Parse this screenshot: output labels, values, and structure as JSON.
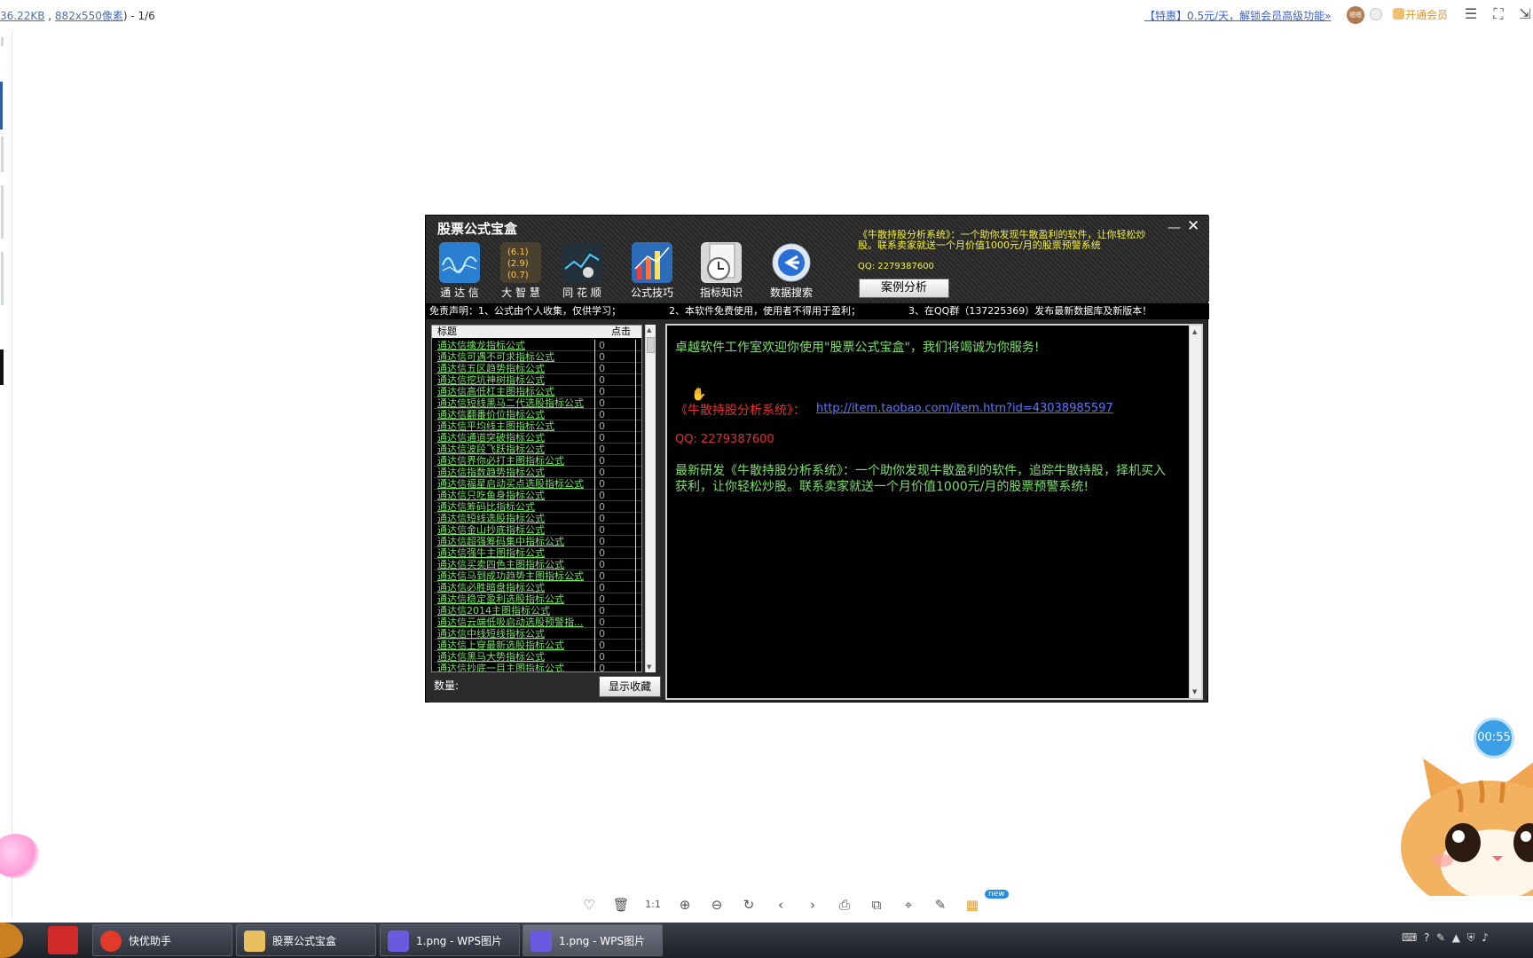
{
  "viewer": {
    "file_size": "36.22KB",
    "comma": " , ",
    "dimensions": "882x550像素",
    "page_indicator": ") - 1/6",
    "promo_link": "【特惠】0.5元/天，解锁会员高级功能»",
    "avatar_text": "嗯嗯",
    "vip_label": "开通会员"
  },
  "app": {
    "title": "股票公式宝盒",
    "minimize": "—",
    "close": "✕",
    "toolbar": [
      {
        "label": "通 达 信",
        "icon": "chart-wave-icon"
      },
      {
        "label": "大 智 慧",
        "icon": "numbers-icon"
      },
      {
        "label": "同 花 顺",
        "icon": "hand-chart-icon"
      },
      {
        "label": "公式技巧",
        "icon": "bar-graph-icon"
      },
      {
        "label": "指标知识",
        "icon": "clock-doc-icon"
      },
      {
        "label": "数据搜索",
        "icon": "arrow-back-icon"
      }
    ],
    "promo_text": "《牛散持股分析系统》：一个助你发现牛散盈利的软件，让你轻松炒股。联系卖家就送一个月价值1000元/月的股票预警系统",
    "promo_qq": "QQ: 2279387600",
    "case_button": "案例分析",
    "marquee": [
      "免责声明：1、公式由个人收集，仅供学习；",
      "2、本软件免费使用，使用者不得用于盈利；",
      "3、在QQ群（137225369）发布最新数据库及新版本！"
    ],
    "list": {
      "col_title": "标题",
      "col_clicks": "点击",
      "rows": [
        {
          "title": "通达信擒龙指标公式",
          "clicks": "0"
        },
        {
          "title": "通达信可遇不可求指标公式",
          "clicks": "0"
        },
        {
          "title": "通达信五区趋势指标公式",
          "clicks": "0"
        },
        {
          "title": "通达信挖坑神树指标公式",
          "clicks": "0"
        },
        {
          "title": "通达信高低杠主图指标公式",
          "clicks": "0"
        },
        {
          "title": "通达信短线黑马二代选股指标公式",
          "clicks": "0"
        },
        {
          "title": "通达信翻番价位指标公式",
          "clicks": "0"
        },
        {
          "title": "通达信平均线主图指标公式",
          "clicks": "0"
        },
        {
          "title": "通达信通道突破指标公式",
          "clicks": "0"
        },
        {
          "title": "通达信波段飞跃指标公式",
          "clicks": "0"
        },
        {
          "title": "通达信界你必打主图指标公式",
          "clicks": "0"
        },
        {
          "title": "通达信指数趋势指标公式",
          "clicks": "0"
        },
        {
          "title": "通达信福星启动买点选股指标公式",
          "clicks": "0"
        },
        {
          "title": "通达信只吃鱼身指标公式",
          "clicks": "0"
        },
        {
          "title": "通达信筹码比指标公式",
          "clicks": "0"
        },
        {
          "title": "通达信短线选股指标公式",
          "clicks": "0"
        },
        {
          "title": "通达信金山抄底指标公式",
          "clicks": "0"
        },
        {
          "title": "通达信超强筹码集中指标公式",
          "clicks": "0"
        },
        {
          "title": "通达信强牛主图指标公式",
          "clicks": "0"
        },
        {
          "title": "通达信买卖四色主图指标公式",
          "clicks": "0"
        },
        {
          "title": "通达信马到成功趋势主图指标公式",
          "clicks": "0"
        },
        {
          "title": "通达信必胜暗盘指标公式",
          "clicks": "0"
        },
        {
          "title": "通达信稳定盈利选股指标公式",
          "clicks": "0"
        },
        {
          "title": "通达信2014主图指标公式",
          "clicks": "0"
        },
        {
          "title": "通达信云端低吸启动选股预警指...",
          "clicks": "0"
        },
        {
          "title": "通达信中线短线指标公式",
          "clicks": "0"
        },
        {
          "title": "通达信上穿最新选股指标公式",
          "clicks": "0"
        },
        {
          "title": "通达信黑马大势指标公式",
          "clicks": "0"
        },
        {
          "title": "通达信抄底一目主图指标公式",
          "clicks": "0"
        }
      ]
    },
    "count_label": "数量:",
    "favorites_button": "显示收藏",
    "content": {
      "welcome": "卓越软件工作室欢迎你使用\"股票公式宝盒\"，我们将竭诚为你服务!",
      "system_label": "《牛散持股分析系统》：",
      "system_link": "http://item.taobao.com/item.htm?id=43038985597",
      "qq": "QQ: 2279387600",
      "description": "最新研发《牛散持股分析系统》：一个助你发现牛散盈利的软件，追踪牛散持股，择机买入获利，让你轻松炒股。联系卖家就送一个月价值1000元/月的股票预警系统!"
    }
  },
  "bottom_toolbar": {
    "new_badge": "new"
  },
  "timer": "00:55",
  "taskbar": {
    "items": [
      {
        "label": "快优助手",
        "color": "#e23a2a"
      },
      {
        "label": "股票公式宝盒",
        "color": "#e8c060"
      },
      {
        "label": "1.png - WPS图片",
        "color": "#6a5ae0"
      },
      {
        "label": "1.png - WPS图片",
        "color": "#6a5ae0"
      }
    ]
  },
  "colors": {
    "list_text": "#7be06a",
    "promo_yellow": "#f4f040",
    "link_blue": "#5a78ff",
    "alert_red": "#e53030"
  }
}
